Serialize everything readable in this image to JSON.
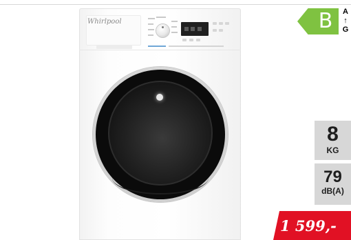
{
  "product": {
    "brand": "Whirlpool"
  },
  "energy": {
    "class": "B",
    "scale_top": "A",
    "scale_arrow": "↑",
    "scale_bottom": "G",
    "color": "#7fc241"
  },
  "specs": {
    "capacity_value": "8",
    "capacity_unit": "KG",
    "noise_value": "79",
    "noise_unit": "dB(A)"
  },
  "price": {
    "text": "1 599,-",
    "color": "#e11124"
  }
}
